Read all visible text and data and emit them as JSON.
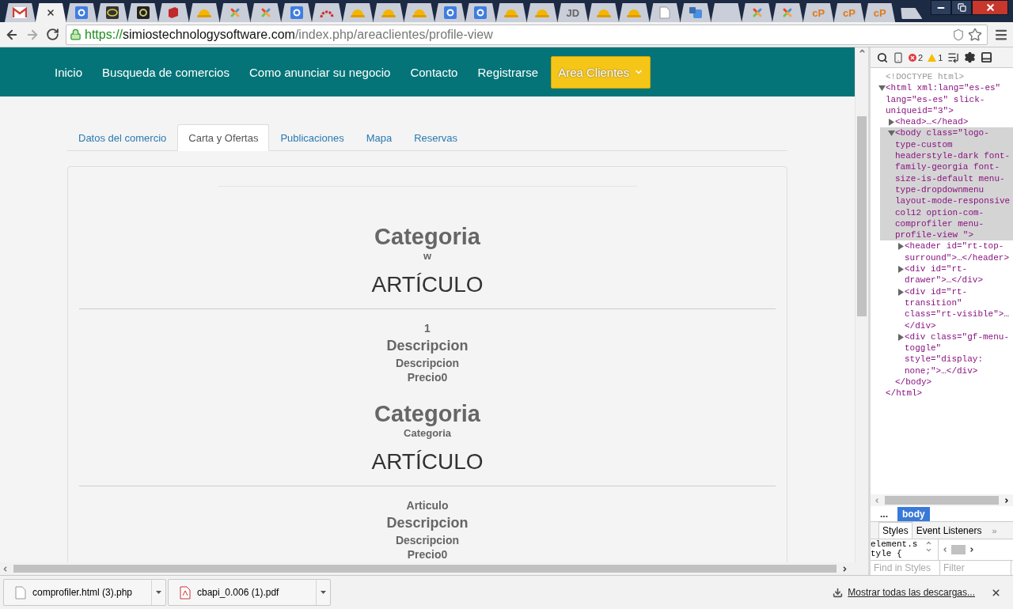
{
  "browser_tabs": [
    {
      "kind": "gmail",
      "selected": false
    },
    {
      "kind": "blank",
      "selected": true
    },
    {
      "kind": "google",
      "selected": false
    },
    {
      "kind": "eye",
      "selected": false
    },
    {
      "kind": "ring",
      "selected": false
    },
    {
      "kind": "book",
      "selected": false
    },
    {
      "kind": "hat",
      "selected": false
    },
    {
      "kind": "joomla",
      "selected": false
    },
    {
      "kind": "joomla",
      "selected": false
    },
    {
      "kind": "google",
      "selected": false
    },
    {
      "kind": "arch",
      "selected": false
    },
    {
      "kind": "hat",
      "selected": false
    },
    {
      "kind": "hat",
      "selected": false
    },
    {
      "kind": "hat",
      "selected": false
    },
    {
      "kind": "google",
      "selected": false
    },
    {
      "kind": "google",
      "selected": false
    },
    {
      "kind": "hat",
      "selected": false
    },
    {
      "kind": "hat",
      "selected": false
    },
    {
      "kind": "text",
      "label": "JD",
      "selected": false
    },
    {
      "kind": "hat",
      "selected": false
    },
    {
      "kind": "hat",
      "selected": false
    },
    {
      "kind": "page",
      "selected": false
    },
    {
      "kind": "translate",
      "selected": false
    },
    {
      "kind": "blank",
      "selected": false
    },
    {
      "kind": "joomla",
      "selected": false
    },
    {
      "kind": "joomla",
      "selected": false
    },
    {
      "kind": "text",
      "label": "cP",
      "selected": false
    },
    {
      "kind": "text",
      "label": "cP",
      "selected": false
    },
    {
      "kind": "text",
      "label": "cP",
      "selected": false
    }
  ],
  "address_bar": {
    "scheme": "https://",
    "host": "simiostechnologysoftware.com",
    "path": "/index.php/areaclientes/profile-view"
  },
  "site_nav": [
    {
      "label": "Inicio",
      "selected": false,
      "has_dropdown": false
    },
    {
      "label": "Busqueda de comercios",
      "selected": false,
      "has_dropdown": false
    },
    {
      "label": "Como anunciar su negocio",
      "selected": false,
      "has_dropdown": false
    },
    {
      "label": "Contacto",
      "selected": false,
      "has_dropdown": false
    },
    {
      "label": "Registrarse",
      "selected": false,
      "has_dropdown": false
    },
    {
      "label": "Area Clientes",
      "selected": true,
      "has_dropdown": true
    }
  ],
  "profile_tabs": [
    {
      "label": "Datos del comercio",
      "selected": false
    },
    {
      "label": "Carta y Ofertas",
      "selected": true
    },
    {
      "label": "Publicaciones",
      "selected": false
    },
    {
      "label": "Mapa",
      "selected": false
    },
    {
      "label": "Reservas",
      "selected": false
    }
  ],
  "blocks": [
    {
      "kind": "category",
      "title": "Categoria",
      "subtitle": "w"
    },
    {
      "kind": "article",
      "title": "ARTÍCULO"
    },
    {
      "kind": "item",
      "number": "1",
      "name": "Descripcion",
      "description": "Descripcion",
      "price": "Precio0"
    },
    {
      "kind": "category",
      "title": "Categoria",
      "subtitle": "Categoria"
    },
    {
      "kind": "article",
      "title": "ARTÍCULO"
    },
    {
      "kind": "item",
      "number": "Articulo",
      "name": "Descripcion",
      "description": "Descripcion",
      "price": "Precio0"
    }
  ],
  "devtools": {
    "error_count": "2",
    "warning_count": "1",
    "dom_tree": [
      {
        "kind": "doctype",
        "text": "<!DOCTYPE html>"
      },
      {
        "kind": "element",
        "text": "<html xml:lang=\"es-es\" lang=\"es-es\" slick-uniqueid=\"3\">",
        "expanded": true,
        "selected": false,
        "closing": "</html>",
        "children": [
          {
            "kind": "element",
            "text": "<head>…</head>",
            "expanded": false,
            "selected": false
          },
          {
            "kind": "element",
            "text": "<body class=\"logo-type-custom headerstyle-dark font-family-georgia font-size-is-default menu-type-dropdownmenu layout-mode-responsive col12 option-com-comprofiler menu-profile-view \">",
            "expanded": true,
            "selected": true,
            "closing": "</body>",
            "children": [
              {
                "kind": "element",
                "text": "<header id=\"rt-top-surround\">…</header>",
                "expanded": false,
                "selected": false
              },
              {
                "kind": "element",
                "text": "<div id=\"rt-drawer\">…</div>",
                "expanded": false,
                "selected": false
              },
              {
                "kind": "element",
                "text": "<div id=\"rt-transition\" class=\"rt-visible\">…</div>",
                "expanded": false,
                "selected": false
              },
              {
                "kind": "element",
                "text": "<div class=\"gf-menu-toggle\" style=\"display: none;\">…</div>",
                "expanded": false,
                "selected": false
              }
            ]
          }
        ]
      }
    ],
    "breadcrumb": [
      {
        "label": "...",
        "selected": false
      },
      {
        "label": "body",
        "selected": true
      }
    ],
    "panel_tabs": [
      {
        "label": "Styles",
        "selected": true
      },
      {
        "label": "Event Listeners",
        "selected": false
      }
    ],
    "more_tabs": "»",
    "styles_text": "element.style {",
    "find_placeholder": "Find in Styles",
    "filter_placeholder": "Filter"
  },
  "downloads": {
    "files": [
      {
        "kind": "file",
        "name": "comprofiler.html (3).php"
      },
      {
        "kind": "pdf",
        "name": "cbapi_0.006 (1).pdf"
      }
    ],
    "show_all": "Mostrar todas las descargas..."
  }
}
